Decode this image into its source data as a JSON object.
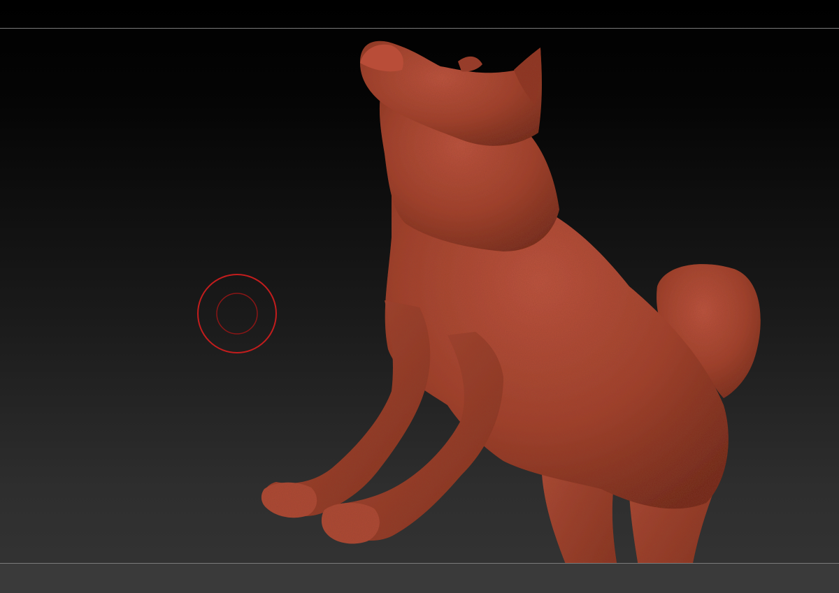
{
  "canvas": {
    "background_top": "#000000",
    "background_bottom": "#343434",
    "guide_line_color": "#7b7b7b"
  },
  "model": {
    "subject": "dog-sculpt",
    "material_color": "#a4402c",
    "shadow_color": "#6e2417",
    "highlight_color": "#c65a43"
  },
  "brush": {
    "outer_color": "#c31d1d",
    "inner_color": "#8a1616"
  }
}
